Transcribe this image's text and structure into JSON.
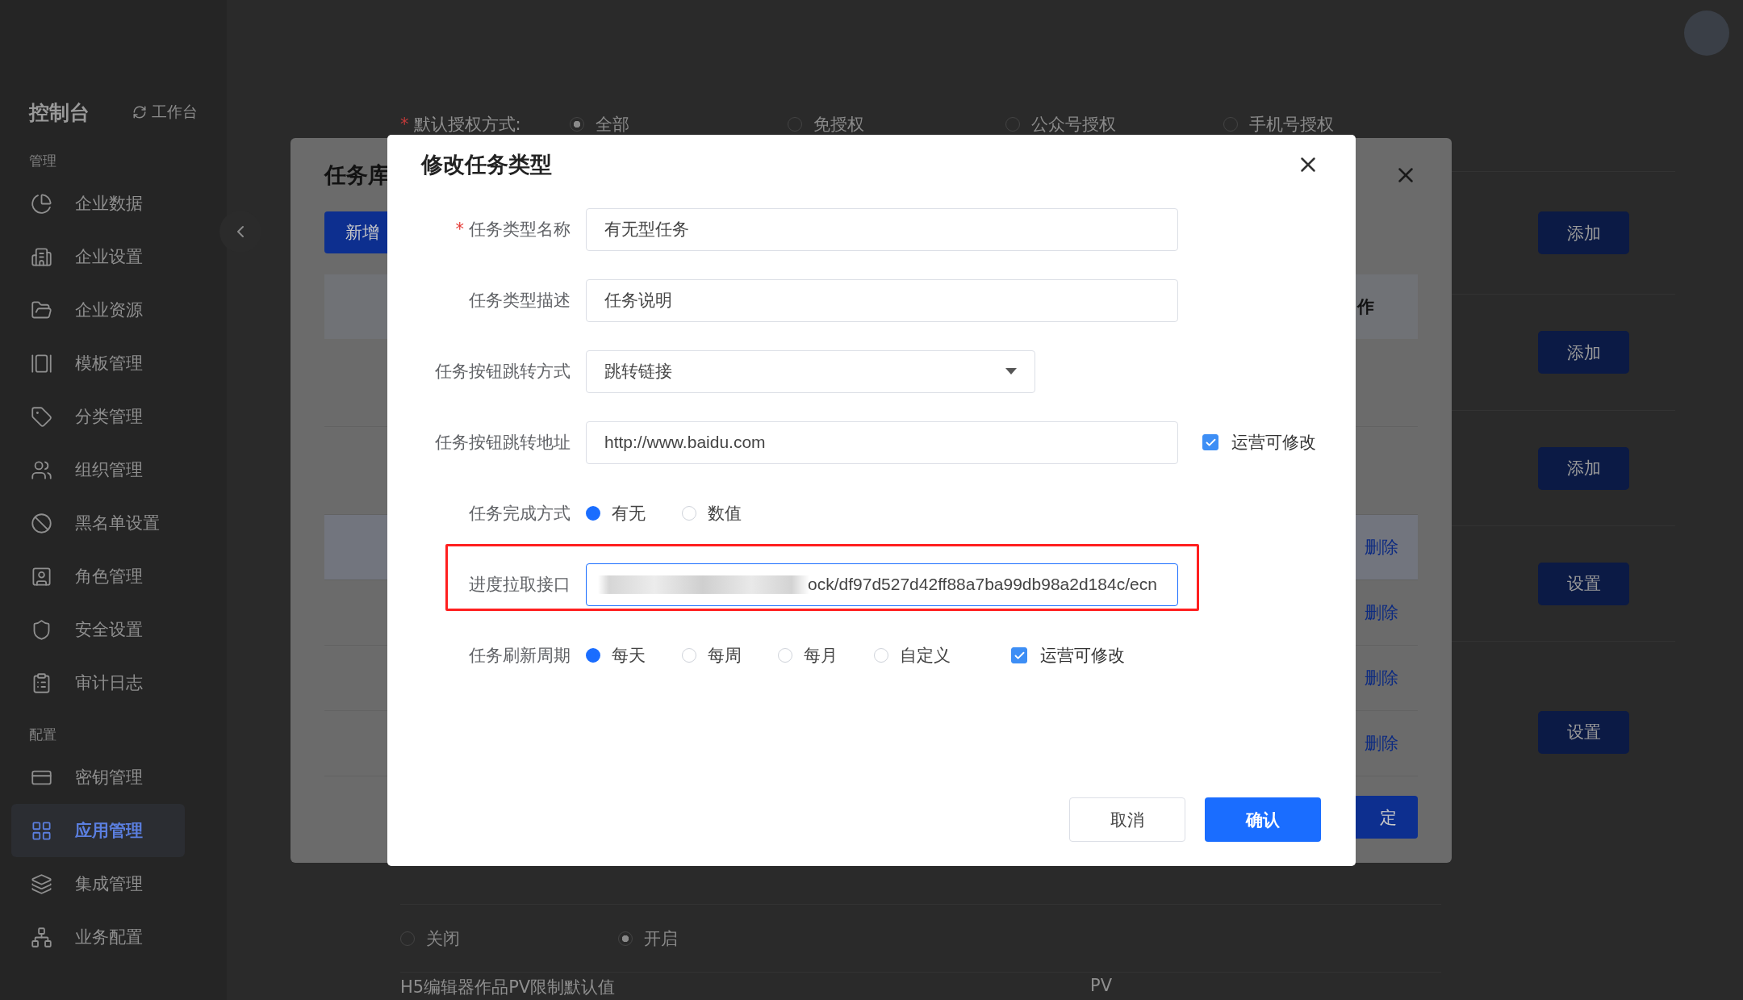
{
  "sidebar": {
    "title": "控制台",
    "workbench_link": "工作台",
    "groups": [
      {
        "label": "管理",
        "items": [
          {
            "label": "企业数据",
            "selected": false
          },
          {
            "label": "企业设置",
            "selected": false
          },
          {
            "label": "企业资源",
            "selected": false
          },
          {
            "label": "模板管理",
            "selected": false
          },
          {
            "label": "分类管理",
            "selected": false
          },
          {
            "label": "组织管理",
            "selected": false
          },
          {
            "label": "黑名单设置",
            "selected": false
          },
          {
            "label": "角色管理",
            "selected": false
          },
          {
            "label": "安全设置",
            "selected": false
          },
          {
            "label": "审计日志",
            "selected": false
          }
        ]
      },
      {
        "label": "配置",
        "items": [
          {
            "label": "密钥管理",
            "selected": false
          },
          {
            "label": "应用管理",
            "selected": true
          },
          {
            "label": "集成管理",
            "selected": false
          },
          {
            "label": "业务配置",
            "selected": false
          }
        ]
      }
    ]
  },
  "page": {
    "auth_method": {
      "label": "默认授权方式:",
      "required_mark": "*",
      "options": [
        {
          "label": "全部",
          "selected": true
        },
        {
          "label": "免授权",
          "selected": false
        },
        {
          "label": "公众号授权",
          "selected": false
        },
        {
          "label": "手机号授权",
          "selected": false
        }
      ]
    },
    "row_buttons": [
      "添加",
      "添加",
      "添加",
      "设置",
      "设置"
    ],
    "toggle": {
      "options": [
        {
          "label": "关闭",
          "selected": false
        },
        {
          "label": "开启",
          "selected": true
        }
      ]
    },
    "pv_limit": {
      "label": "H5编辑器作品PV限制默认值",
      "value": "PV"
    }
  },
  "task_library_dialog": {
    "title": "任务库",
    "add_button": "新增",
    "header_cell": "作",
    "row_actions": [
      {
        "label": "删除",
        "selected": true
      },
      {
        "label": "删除",
        "selected": false
      },
      {
        "label": "删除",
        "selected": false
      },
      {
        "label": "删除",
        "selected": false
      }
    ],
    "confirm_button": "定"
  },
  "dialog": {
    "title": "修改任务类型",
    "fields": [
      {
        "kind": "text",
        "label": "任务类型名称",
        "required_mark": "*",
        "value": "有无型任务"
      },
      {
        "kind": "text",
        "label": "任务类型描述",
        "value": "任务说明"
      },
      {
        "kind": "select",
        "label": "任务按钮跳转方式",
        "value": "跳转链接"
      },
      {
        "kind": "text",
        "label": "任务按钮跳转地址",
        "value": "http://www.baidu.com",
        "operator_editable": {
          "label": "运营可修改",
          "checked": true
        }
      },
      {
        "kind": "radio",
        "label": "任务完成方式",
        "options": [
          {
            "label": "有无",
            "selected": true
          },
          {
            "label": "数值",
            "selected": false
          }
        ]
      },
      {
        "kind": "text",
        "label": "进度拉取接口",
        "value": "ock/df97d527d42ff88a7ba99db98a2d184c/ecn",
        "redacted": true,
        "focused": true,
        "highlighted": true
      },
      {
        "kind": "radio",
        "label": "任务刷新周期",
        "options": [
          {
            "label": "每天",
            "selected": true
          },
          {
            "label": "每周",
            "selected": false
          },
          {
            "label": "每月",
            "selected": false
          },
          {
            "label": "自定义",
            "selected": false
          }
        ],
        "operator_editable": {
          "label": "运营可修改",
          "checked": true
        }
      }
    ],
    "buttons": [
      {
        "label": "取消",
        "kind": "default"
      },
      {
        "label": "确认",
        "kind": "primary"
      }
    ]
  }
}
